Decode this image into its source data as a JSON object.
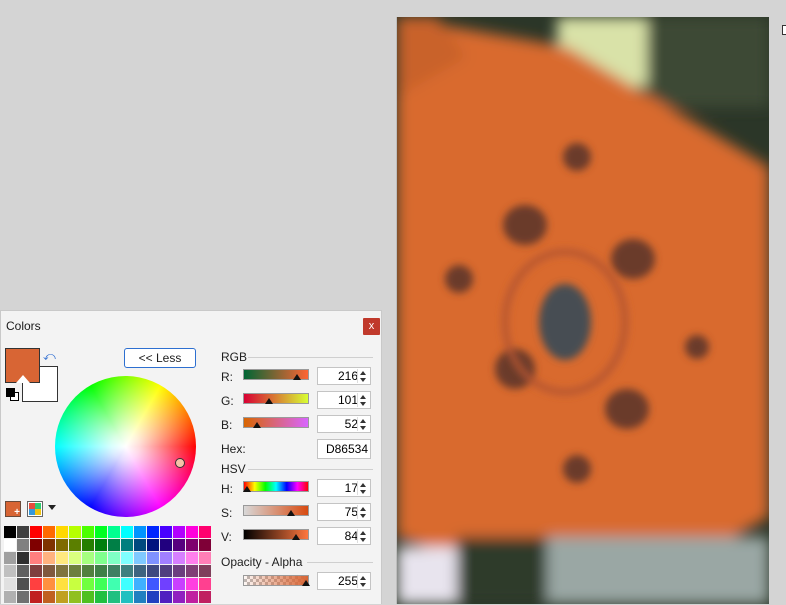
{
  "panel": {
    "title": "Colors",
    "close_label": "x",
    "less_button": "<< Less"
  },
  "colors": {
    "primary": "#D86534",
    "secondary": "#FFFFFF"
  },
  "rgb": {
    "section": "RGB",
    "r_label": "R:",
    "r_value": "216",
    "g_label": "G:",
    "g_value": "101",
    "b_label": "B:",
    "b_value": "52"
  },
  "hex": {
    "label": "Hex:",
    "value": "D86534"
  },
  "hsv": {
    "section": "HSV",
    "h_label": "H:",
    "h_value": "17",
    "s_label": "S:",
    "s_value": "75",
    "v_label": "V:",
    "v_value": "84"
  },
  "alpha": {
    "section": "Opacity - Alpha",
    "value": "255"
  },
  "slider_levels": {
    "r": 0.847,
    "g": 0.396,
    "b": 0.204,
    "h": 0.047,
    "s": 0.75,
    "v": 0.84,
    "alpha": 1.0
  },
  "palette_rows": [
    [
      "#000000",
      "#404040",
      "#ff0000",
      "#ff6a00",
      "#ffd800",
      "#b6ff00",
      "#4cff00",
      "#00ff21",
      "#00ff90",
      "#00ffff",
      "#0094ff",
      "#0026ff",
      "#4800ff",
      "#b200ff",
      "#ff00dc",
      "#ff006e"
    ],
    [
      "#ffffff",
      "#808080",
      "#7f0000",
      "#7f3300",
      "#7f6a00",
      "#5b7f00",
      "#267f00",
      "#007f0e",
      "#007f46",
      "#007f7f",
      "#004a7f",
      "#00137f",
      "#21007f",
      "#57007f",
      "#7f006e",
      "#7f0037"
    ],
    [
      "#a0a0a0",
      "#303030",
      "#ff7f7f",
      "#ffb27f",
      "#ffe97f",
      "#daff7f",
      "#a5ff7f",
      "#7fff8e",
      "#7fffc5",
      "#7fffff",
      "#7fc9ff",
      "#7f92ff",
      "#a17fff",
      "#d67fff",
      "#ff7fed",
      "#ff7fb6"
    ],
    [
      "#c0c0c0",
      "#606060",
      "#7f3f3f",
      "#7f593f",
      "#7f743f",
      "#6d7f3f",
      "#527f3f",
      "#3f7f47",
      "#3f7f62",
      "#3f7f7f",
      "#3f647f",
      "#3f497f",
      "#503f7f",
      "#6b3f7f",
      "#7f3f76",
      "#7f3f5b"
    ],
    [
      "#e0e0e0",
      "#505050",
      "#ff4040",
      "#ff9040",
      "#ffe040",
      "#c8ff40",
      "#70ff40",
      "#40ff58",
      "#40ffb0",
      "#40ffff",
      "#40b0ff",
      "#4058ff",
      "#7040ff",
      "#c840ff",
      "#ff40e0",
      "#ff4090"
    ],
    [
      "#b0b0b0",
      "#707070",
      "#c02020",
      "#c06020",
      "#c0a020",
      "#90c020",
      "#50c020",
      "#20c040",
      "#20c080",
      "#20c0c0",
      "#2080c0",
      "#2040c0",
      "#5020c0",
      "#9020c0",
      "#c020a0",
      "#c02060"
    ]
  ],
  "icons": {
    "swap": "swap-icon",
    "reset": "reset-colors-icon",
    "add": "add-color-icon",
    "palette": "palette-icon",
    "menu": "palette-menu-icon"
  }
}
